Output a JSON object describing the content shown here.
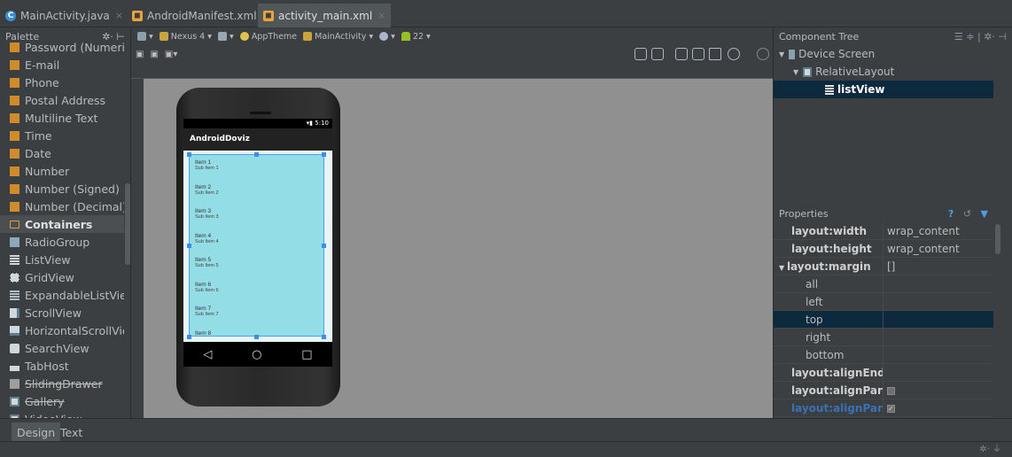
{
  "tabs": [
    {
      "label": "MainActivity.java",
      "kind": "java"
    },
    {
      "label": "AndroidManifest.xml",
      "kind": "xml"
    },
    {
      "label": "activity_main.xml",
      "kind": "xml",
      "active": true
    }
  ],
  "palette": {
    "title": "Palette",
    "items": [
      {
        "label": "Password (Numeric)",
        "icon": "text-field-icon"
      },
      {
        "label": "E-mail",
        "icon": "text-field-icon"
      },
      {
        "label": "Phone",
        "icon": "text-field-icon"
      },
      {
        "label": "Postal Address",
        "icon": "text-field-icon"
      },
      {
        "label": "Multiline Text",
        "icon": "text-field-icon"
      },
      {
        "label": "Time",
        "icon": "text-field-icon"
      },
      {
        "label": "Date",
        "icon": "text-field-icon"
      },
      {
        "label": "Number",
        "icon": "text-field-icon"
      },
      {
        "label": "Number (Signed)",
        "icon": "text-field-icon"
      },
      {
        "label": "Number (Decimal)",
        "icon": "text-field-icon"
      },
      {
        "label": "Containers",
        "icon": "folder-icon",
        "section": true
      },
      {
        "label": "RadioGroup",
        "icon": "radiogroup-icon"
      },
      {
        "label": "ListView",
        "icon": "listview-icon"
      },
      {
        "label": "GridView",
        "icon": "gridview-icon"
      },
      {
        "label": "ExpandableListView",
        "icon": "expandable-list-icon"
      },
      {
        "label": "ScrollView",
        "icon": "scrollview-icon"
      },
      {
        "label": "HorizontalScrollView",
        "icon": "horizontal-scroll-icon"
      },
      {
        "label": "SearchView",
        "icon": "searchview-icon"
      },
      {
        "label": "TabHost",
        "icon": "tabhost-icon"
      },
      {
        "label": "SlidingDrawer",
        "icon": "slidingdrawer-icon",
        "deprecated": true
      },
      {
        "label": "Gallery",
        "icon": "gallery-icon",
        "deprecated": true
      },
      {
        "label": "VideoView",
        "icon": "videoview-icon"
      }
    ]
  },
  "toolbar": {
    "device": "Nexus 4",
    "theme": "AppTheme",
    "activity": "MainActivity",
    "api": "22"
  },
  "phone": {
    "status_time": "5:10",
    "app_title": "AndroidDoviz",
    "list_items": [
      {
        "title": "Item 1",
        "sub": "Sub Item 1"
      },
      {
        "title": "Item 2",
        "sub": "Sub Item 2"
      },
      {
        "title": "Item 3",
        "sub": "Sub Item 3"
      },
      {
        "title": "Item 4",
        "sub": "Sub Item 4"
      },
      {
        "title": "Item 5",
        "sub": "Sub Item 5"
      },
      {
        "title": "Item 6",
        "sub": "Sub Item 6"
      },
      {
        "title": "Item 7",
        "sub": "Sub Item 7"
      },
      {
        "title": "Item 8",
        "sub": ""
      }
    ]
  },
  "component_tree": {
    "title": "Component Tree",
    "nodes": [
      {
        "label": "Device Screen",
        "depth": 0,
        "icon": "device-icon"
      },
      {
        "label": "RelativeLayout",
        "depth": 1,
        "icon": "relativelayout-icon"
      },
      {
        "label": "listView",
        "depth": 2,
        "icon": "listview-icon",
        "selected": true
      }
    ]
  },
  "properties": {
    "title": "Properties",
    "rows": [
      {
        "name": "layout:width",
        "value": "wrap_content",
        "style": "bold"
      },
      {
        "name": "layout:height",
        "value": "wrap_content",
        "style": "bold"
      },
      {
        "name": "layout:margin",
        "value": "[]",
        "style": "bold",
        "expandable": true
      },
      {
        "name": "all",
        "value": "",
        "style": "indent"
      },
      {
        "name": "left",
        "value": "",
        "style": "indent"
      },
      {
        "name": "top",
        "value": "",
        "style": "indent",
        "selected": true
      },
      {
        "name": "right",
        "value": "",
        "style": "indent"
      },
      {
        "name": "bottom",
        "value": "",
        "style": "indent"
      },
      {
        "name": "layout:alignEnd",
        "value": "",
        "style": "bold"
      },
      {
        "name": "layout:alignParentEnd",
        "value": "",
        "style": "bold",
        "checkbox": false
      },
      {
        "name": "layout:alignParentStart",
        "value": "",
        "style": "link",
        "checkbox": true
      }
    ]
  },
  "bottom_tabs": [
    {
      "label": "Design",
      "active": true
    },
    {
      "label": "Text"
    }
  ],
  "colors": {
    "background": "#3c3f41",
    "selection": "#0d293e",
    "listview_fill": "#93dde6",
    "selection_handle": "#3d8ee8"
  }
}
